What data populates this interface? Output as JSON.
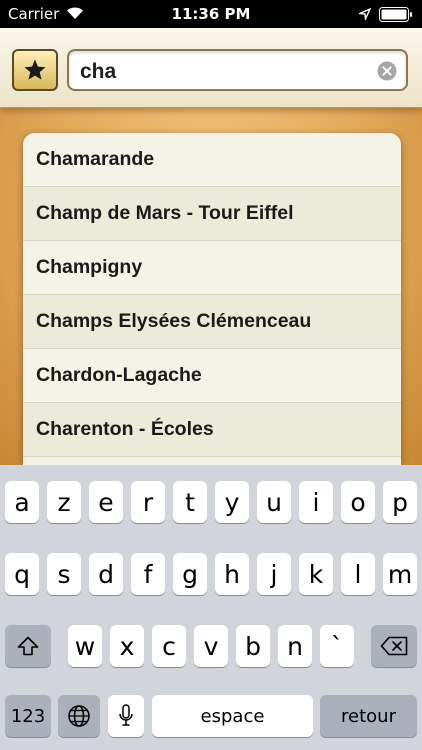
{
  "status_bar": {
    "carrier": "Carrier",
    "time": "11:36 PM"
  },
  "search": {
    "query": "cha"
  },
  "results": [
    "Chamarande",
    "Champ de Mars - Tour Eiffel",
    "Champigny",
    "Champs Elysées Clémenceau",
    "Chardon-Lagache",
    "Charenton - Écoles"
  ],
  "keyboard": {
    "row1": [
      "a",
      "z",
      "e",
      "r",
      "t",
      "y",
      "u",
      "i",
      "o",
      "p"
    ],
    "row2": [
      "q",
      "s",
      "d",
      "f",
      "g",
      "h",
      "j",
      "k",
      "l",
      "m"
    ],
    "row3": [
      "w",
      "x",
      "c",
      "v",
      "b",
      "n",
      "`"
    ],
    "numbers_label": "123",
    "space_label": "espace",
    "return_label": "retour"
  },
  "icons": {
    "favorites": "star-icon",
    "clear": "clear-icon",
    "shift": "shift-icon",
    "delete": "backspace-icon",
    "globe": "globe-icon",
    "mic": "microphone-icon"
  },
  "colors": {
    "parchment": "#e3a85a",
    "keyboard_bg": "#d1d4da"
  }
}
